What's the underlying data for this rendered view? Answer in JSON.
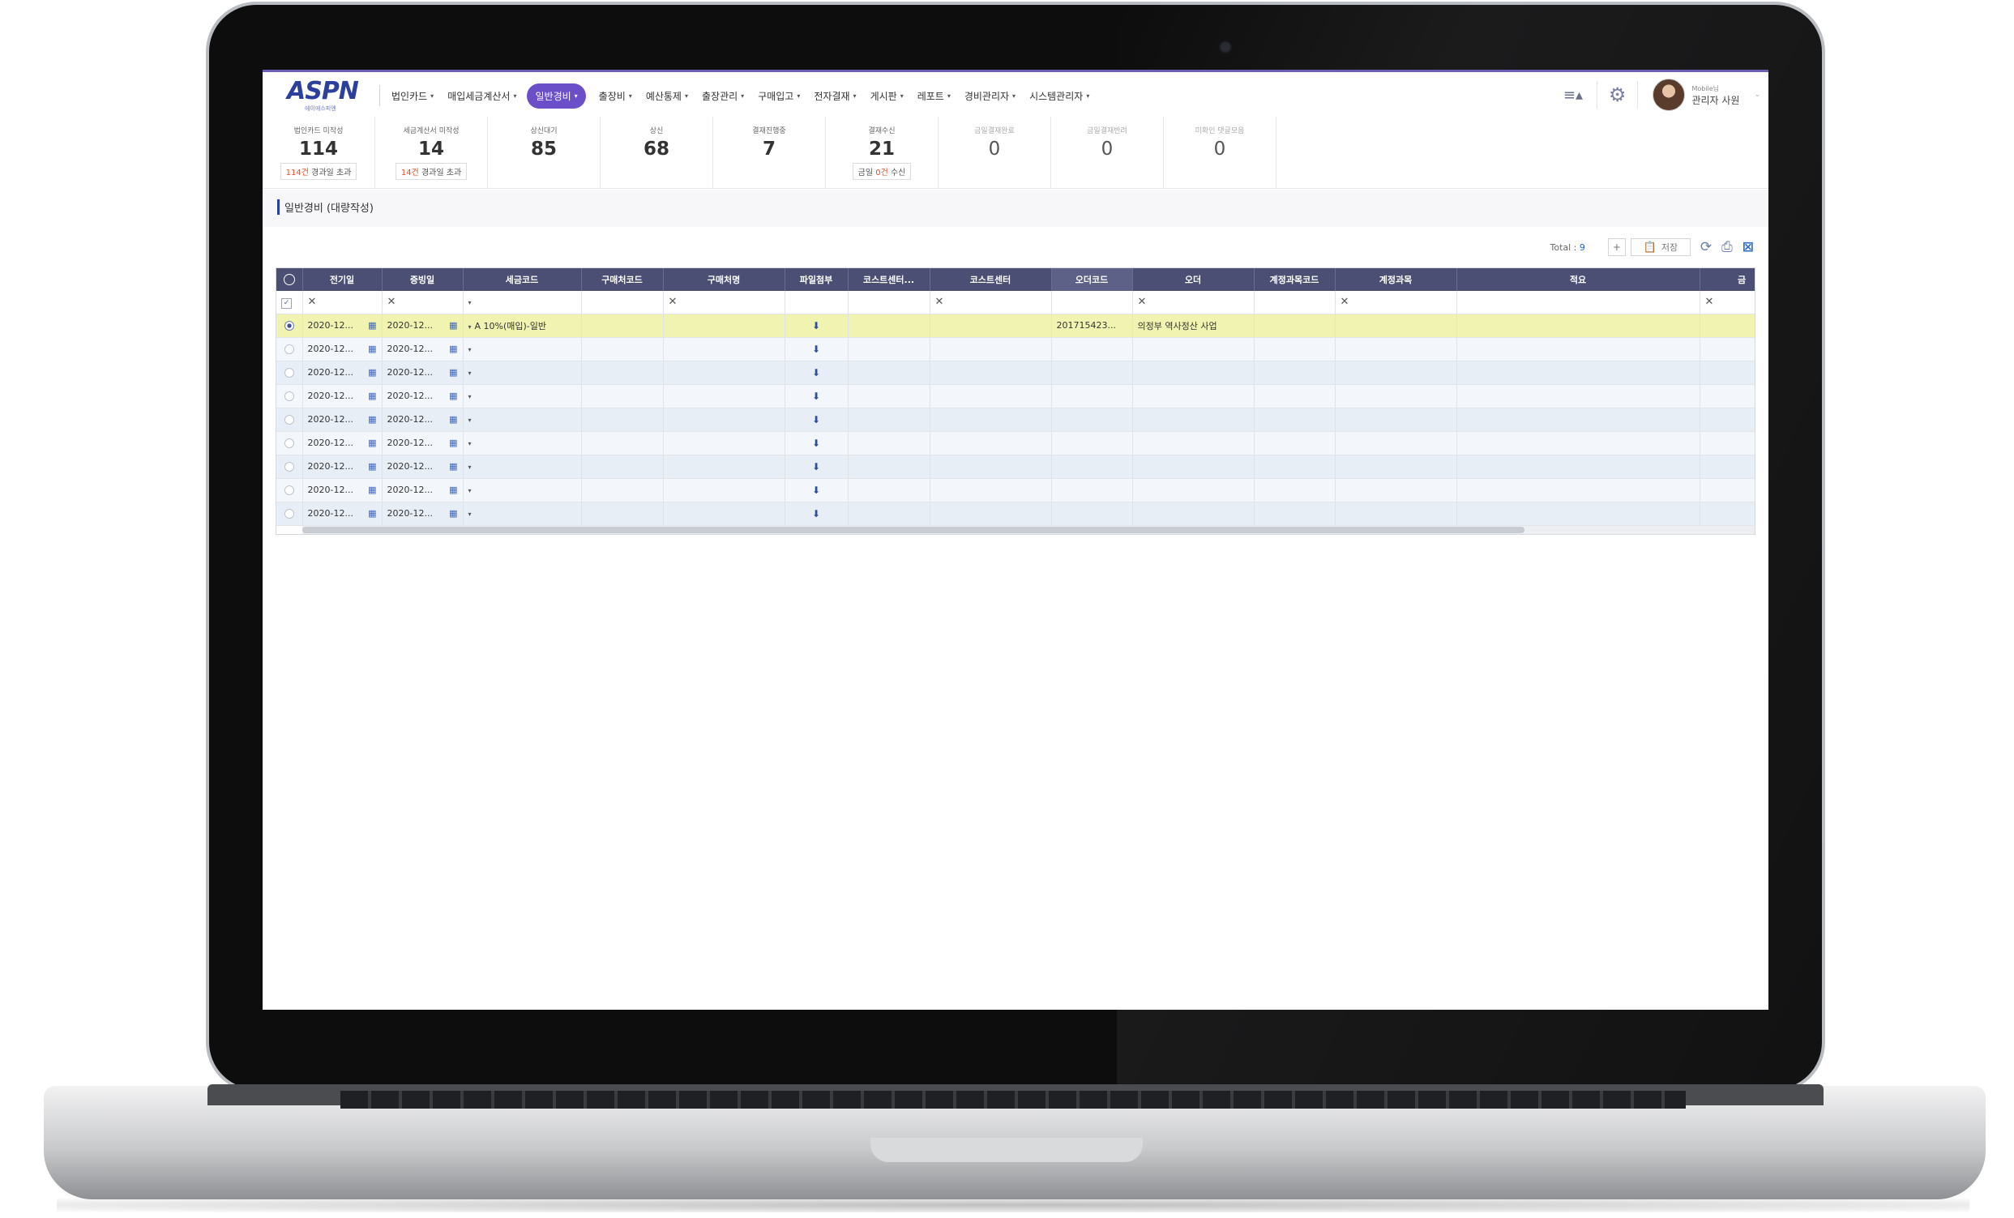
{
  "nav": {
    "logo": "ASPN",
    "logo_sub": "에이에스피엔",
    "items": [
      {
        "label": "법인카드",
        "active": false
      },
      {
        "label": "매입세금계산서",
        "active": false
      },
      {
        "label": "일반경비",
        "active": true
      },
      {
        "label": "출장비",
        "active": false
      },
      {
        "label": "예산통제",
        "active": false
      },
      {
        "label": "출장관리",
        "active": false
      },
      {
        "label": "구매입고",
        "active": false
      },
      {
        "label": "전자결재",
        "active": false
      },
      {
        "label": "게시판",
        "active": false
      },
      {
        "label": "레포트",
        "active": false
      },
      {
        "label": "경비관리자",
        "active": false
      },
      {
        "label": "시스템관리자",
        "active": false
      }
    ]
  },
  "user": {
    "mobile_label": "Mobile님",
    "name": "관리자 사원"
  },
  "stats": [
    {
      "label": "법인카드 미작성",
      "value": "114",
      "sub_count": "114건",
      "sub_text": " 경과일 초과",
      "dim": false
    },
    {
      "label": "세금계산서 미작성",
      "value": "14",
      "sub_count": "14건",
      "sub_text": " 경과일 초과",
      "dim": false
    },
    {
      "label": "상신대기",
      "value": "85",
      "dim": false
    },
    {
      "label": "상신",
      "value": "68",
      "dim": false
    },
    {
      "label": "결재진행중",
      "value": "7",
      "dim": false
    },
    {
      "label": "결재수신",
      "value": "21",
      "sub_prefix": "금일 ",
      "sub_count": "0건",
      "sub_text": " 수신",
      "dim": false
    },
    {
      "label": "금일결재완료",
      "value": "0",
      "dim": true
    },
    {
      "label": "금일결재반려",
      "value": "0",
      "dim": true
    },
    {
      "label": "미확인 댓글모음",
      "value": "0",
      "dim": true
    }
  ],
  "page": {
    "title": "일반경비 (대량작성)"
  },
  "toolbar": {
    "total_label": "Total : ",
    "total_value": "9",
    "save_label": "저장"
  },
  "grid": {
    "columns": [
      "전기일",
      "증빙일",
      "세금코드",
      "구매처코드",
      "구매처명",
      "파일첨부",
      "코스트센터...",
      "코스트센터",
      "오더코드",
      "오더",
      "계정과목코드",
      "계정과목",
      "적요",
      "금"
    ],
    "rows": [
      {
        "posting_date": "2020-12...",
        "evidence_date": "2020-12...",
        "tax_code": "A 10%(매입)-일반",
        "order_code": "201715423...",
        "order": "의정부 역사정산 사업",
        "selected": true
      },
      {
        "posting_date": "2020-12...",
        "evidence_date": "2020-12...",
        "tax_code": "",
        "order_code": "",
        "order": "",
        "selected": false
      },
      {
        "posting_date": "2020-12...",
        "evidence_date": "2020-12...",
        "tax_code": "",
        "order_code": "",
        "order": "",
        "selected": false
      },
      {
        "posting_date": "2020-12...",
        "evidence_date": "2020-12...",
        "tax_code": "",
        "order_code": "",
        "order": "",
        "selected": false
      },
      {
        "posting_date": "2020-12...",
        "evidence_date": "2020-12...",
        "tax_code": "",
        "order_code": "",
        "order": "",
        "selected": false
      },
      {
        "posting_date": "2020-12...",
        "evidence_date": "2020-12...",
        "tax_code": "",
        "order_code": "",
        "order": "",
        "selected": false
      },
      {
        "posting_date": "2020-12...",
        "evidence_date": "2020-12...",
        "tax_code": "",
        "order_code": "",
        "order": "",
        "selected": false
      },
      {
        "posting_date": "2020-12...",
        "evidence_date": "2020-12...",
        "tax_code": "",
        "order_code": "",
        "order": "",
        "selected": false
      },
      {
        "posting_date": "2020-12...",
        "evidence_date": "2020-12...",
        "tax_code": "",
        "order_code": "",
        "order": "",
        "selected": false
      }
    ]
  },
  "icons": {
    "menu": "menu-icon",
    "settings": "gear-icon",
    "calendar": "calendar-icon",
    "download": "download-icon",
    "add": "plus-icon",
    "refresh": "refresh-icon",
    "print": "print-icon",
    "excel": "excel-icon"
  },
  "colors": {
    "accent": "#6a4fc8",
    "header": "#4c4f74",
    "brand": "#2b3f9c",
    "selected_row": "#f0f4b0"
  }
}
